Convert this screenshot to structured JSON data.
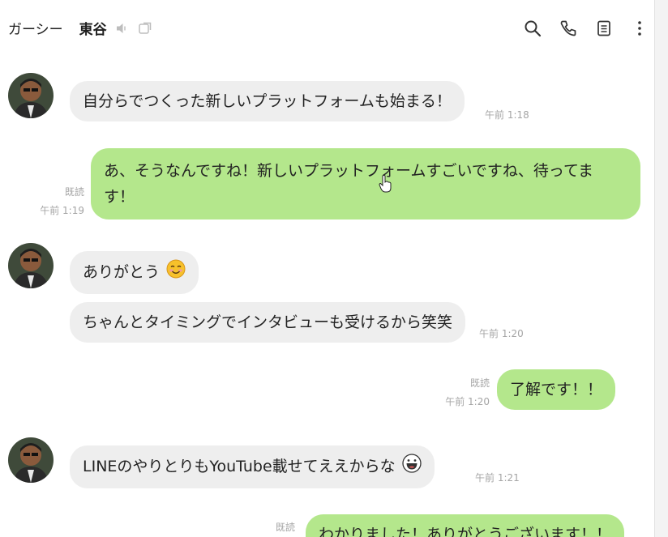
{
  "header": {
    "name1": "ガーシー",
    "name2": "東谷",
    "icons": [
      "mute-icon",
      "external-window-icon",
      "search-icon",
      "phone-icon",
      "note-icon",
      "more-vertical-icon"
    ]
  },
  "messages": [
    {
      "id": "m1",
      "direction": "incoming",
      "text": "自分らでつくった新しいプラットフォームも始まる！",
      "time": "午前 1:18"
    },
    {
      "id": "m2",
      "direction": "outgoing",
      "line1": "あ、そうなんですね！新しいプラットフォームすごいですね、待ってま",
      "line2": "す！",
      "read": "既読",
      "time": "午前 1:19"
    },
    {
      "id": "m3",
      "direction": "incoming",
      "text": "ありがとう",
      "emoji": "smiling-face-emoji"
    },
    {
      "id": "m4",
      "direction": "incoming",
      "text": "ちゃんとタイミングでインタビューも受けるから笑笑",
      "time": "午前 1:20"
    },
    {
      "id": "m5",
      "direction": "outgoing",
      "text": "了解です！！",
      "read": "既読",
      "time": "午前 1:20"
    },
    {
      "id": "m6",
      "direction": "incoming",
      "text": "LINEのやりとりもYouTube載せてええからな",
      "emoji": "grinning-face-emoji",
      "time": "午前 1:21"
    },
    {
      "id": "m7",
      "direction": "outgoing",
      "text": "わかりました！ありがとうございます！！",
      "read": "既読"
    }
  ],
  "colors": {
    "incoming_bubble": "#eeeeee",
    "outgoing_bubble": "#b4e78c",
    "meta_text": "#a5a5a5"
  }
}
